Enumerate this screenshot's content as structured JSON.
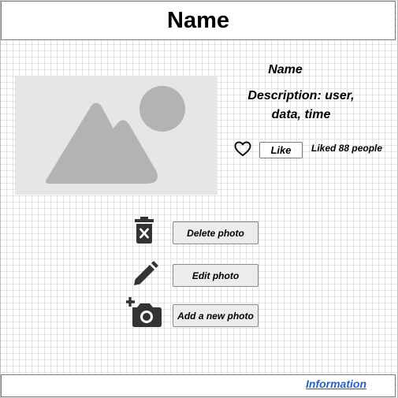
{
  "header": {
    "title": "Name"
  },
  "photo": {
    "icon": "image-placeholder-icon"
  },
  "post": {
    "name": "Name",
    "description": "Description: user, data, time",
    "like_label": "Like",
    "likes_text": "Liked 88 people",
    "like_icon": "heart-outline-icon"
  },
  "actions": [
    {
      "label": "Delete photo",
      "icon": "trash-x-icon"
    },
    {
      "label": "Edit photo",
      "icon": "pencil-icon"
    },
    {
      "label": "Add a new photo",
      "icon": "camera-plus-icon"
    }
  ],
  "footer": {
    "link_label": "Information",
    "link_color": "#1f63c6"
  },
  "colors": {
    "icon": "#333333",
    "placeholder_bg": "#e6e6e6",
    "placeholder_shape": "#b3b3b3"
  }
}
